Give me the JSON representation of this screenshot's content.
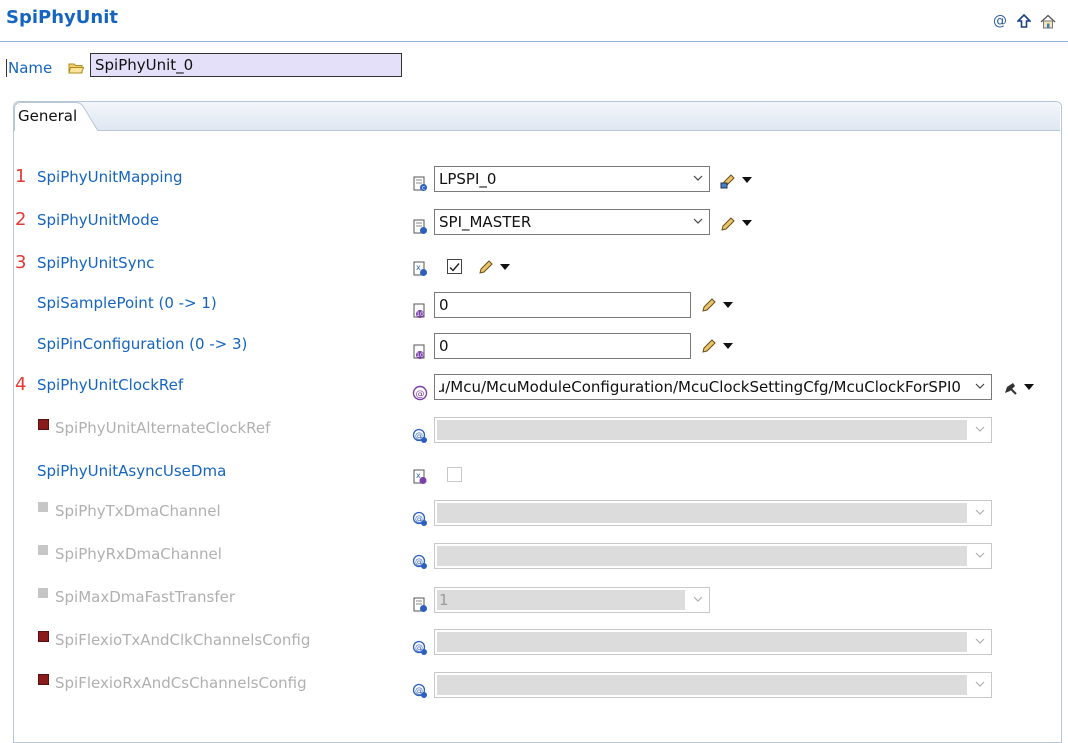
{
  "header": {
    "title": "SpiPhyUnit",
    "icons": [
      "at-icon",
      "up-arrow-icon",
      "home-icon"
    ]
  },
  "name_field": {
    "label": "Name",
    "value": "SpiPhyUnit_0"
  },
  "tabs": [
    {
      "label": "General",
      "selected": true
    }
  ],
  "colors": {
    "accent": "#1565c0",
    "marker_red": "#e53935",
    "disabled_text": "#b0b0b0",
    "disabled_fill": "#dcdcdc"
  },
  "rows": {
    "r0": {
      "marker": "1",
      "label": "SpiPhyUnitMapping",
      "value": "LPSPI_0"
    },
    "r1": {
      "marker": "2",
      "label": "SpiPhyUnitMode",
      "value": "SPI_MASTER"
    },
    "r2": {
      "marker": "3",
      "label": "SpiPhyUnitSync",
      "checked": true
    },
    "r3": {
      "label": "SpiSamplePoint (0 -> 1)",
      "value": "0"
    },
    "r4": {
      "label": "SpiPinConfiguration (0 -> 3)",
      "value": "0"
    },
    "r5": {
      "marker": "4",
      "label": "SpiPhyUnitClockRef",
      "value": "ɹ/Mcu/McuModuleConfiguration/McuClockSettingCfg/McuClockForSPI0"
    },
    "r6": {
      "label": "SpiPhyUnitAlternateClockRef",
      "value": ""
    },
    "r7": {
      "label": "SpiPhyUnitAsyncUseDma",
      "checked": false
    },
    "r8": {
      "label": "SpiPhyTxDmaChannel",
      "value": ""
    },
    "r9": {
      "label": "SpiPhyRxDmaChannel",
      "value": ""
    },
    "r10": {
      "label": "SpiMaxDmaFastTransfer",
      "value": "1"
    },
    "r11": {
      "label": "SpiFlexioTxAndClkChannelsConfig",
      "value": ""
    },
    "r12": {
      "label": "SpiFlexioRxAndCsChannelsConfig",
      "value": ""
    }
  }
}
